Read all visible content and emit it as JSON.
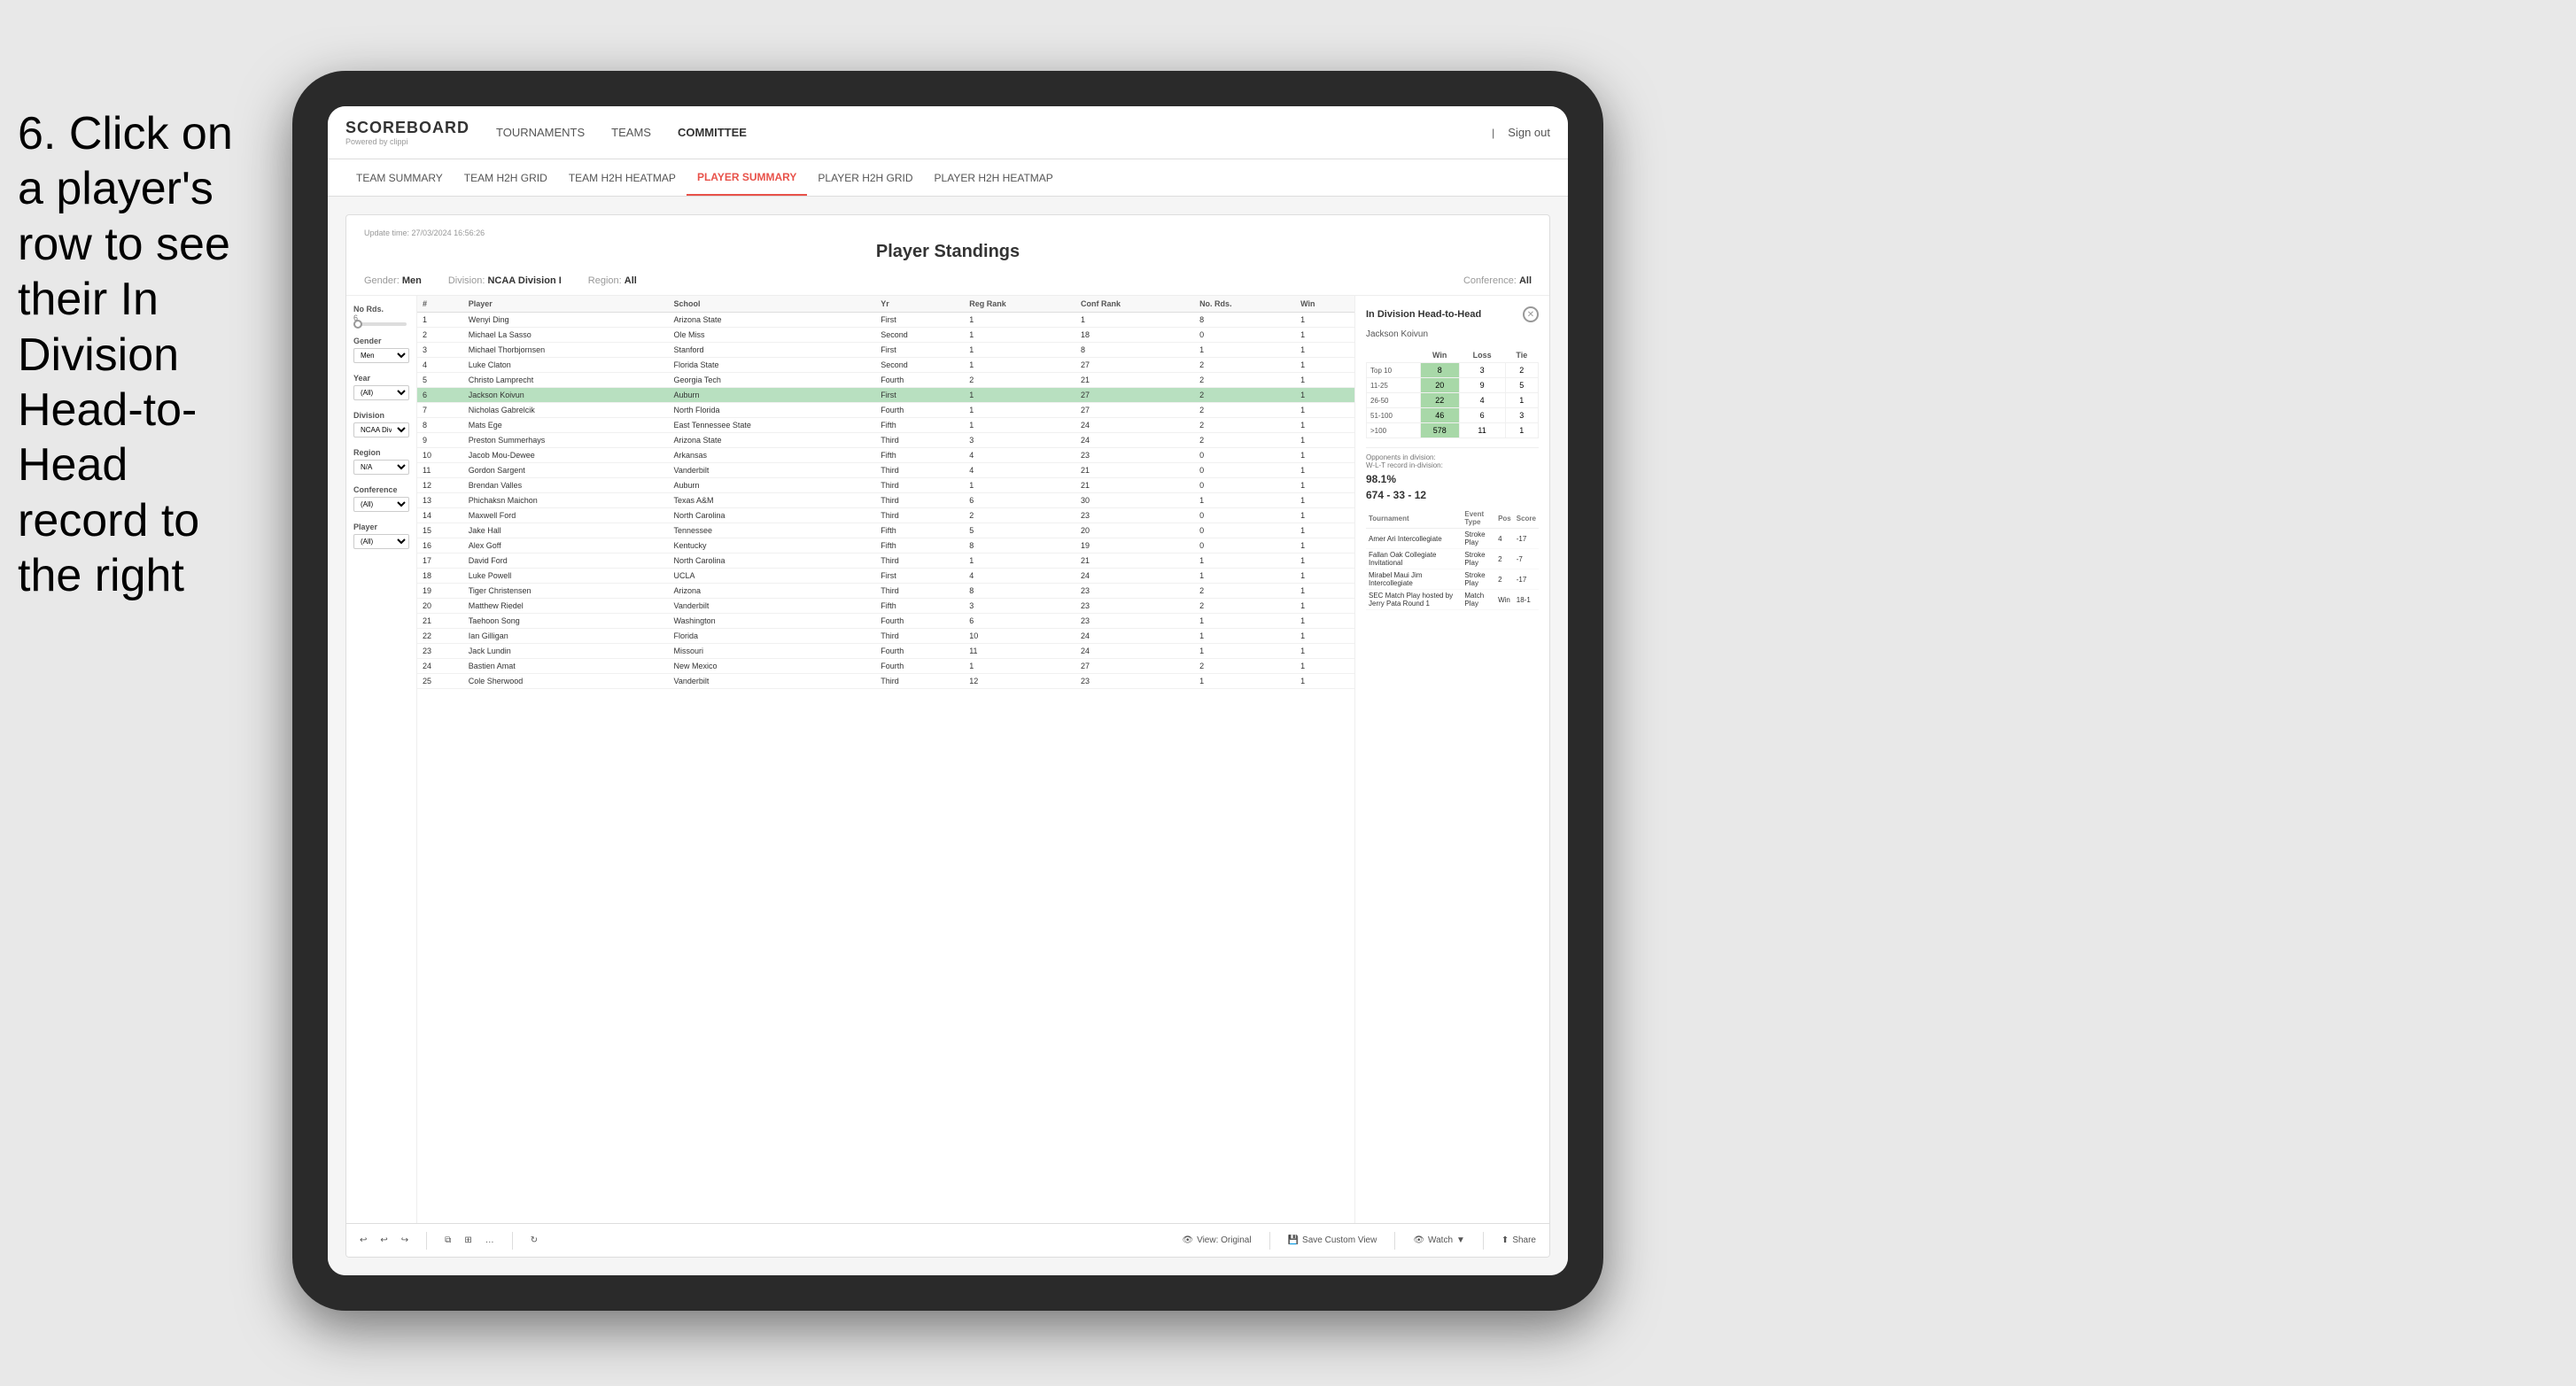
{
  "instruction": {
    "text": "6. Click on a player's row to see their In Division Head-to-Head record to the right"
  },
  "nav": {
    "logo": "SCOREBOARD",
    "powered_by": "Powered by clippi",
    "items": [
      "TOURNAMENTS",
      "TEAMS",
      "COMMITTEE"
    ],
    "sign_out": "Sign out"
  },
  "sub_nav": {
    "items": [
      "TEAM SUMMARY",
      "TEAM H2H GRID",
      "TEAM H2H HEATMAP",
      "PLAYER SUMMARY",
      "PLAYER H2H GRID",
      "PLAYER H2H HEATMAP"
    ],
    "active": "PLAYER SUMMARY"
  },
  "dashboard": {
    "update_label": "Update time:",
    "update_time": "27/03/2024 16:56:26",
    "title": "Player Standings",
    "filters": {
      "gender": {
        "label": "Gender:",
        "value": "Men"
      },
      "division": {
        "label": "Division:",
        "value": "NCAA Division I"
      },
      "region": {
        "label": "Region:",
        "value": "All"
      },
      "conference": {
        "label": "Conference:",
        "value": "All"
      }
    }
  },
  "sidebar_filters": {
    "no_rds_label": "No Rds.",
    "no_rds_value": "6",
    "gender_label": "Gender",
    "gender_value": "Men",
    "year_label": "Year",
    "year_value": "(All)",
    "division_label": "Division",
    "division_value": "NCAA Division I",
    "region_label": "Region",
    "region_value": "N/A",
    "conference_label": "Conference",
    "conference_value": "(All)",
    "player_label": "Player",
    "player_value": "(All)"
  },
  "table": {
    "headers": [
      "#",
      "Player",
      "School",
      "Yr",
      "Reg Rank",
      "Conf Rank",
      "No. Rds.",
      "Win"
    ],
    "rows": [
      {
        "rank": "1",
        "player": "Wenyi Ding",
        "school": "Arizona State",
        "yr": "First",
        "reg": "1",
        "conf": "1",
        "rds": "8",
        "win": "1",
        "highlighted": false
      },
      {
        "rank": "2",
        "player": "Michael La Sasso",
        "school": "Ole Miss",
        "yr": "Second",
        "reg": "1",
        "conf": "18",
        "rds": "0",
        "win": "1",
        "highlighted": false
      },
      {
        "rank": "3",
        "player": "Michael Thorbjornsen",
        "school": "Stanford",
        "yr": "First",
        "reg": "1",
        "conf": "8",
        "rds": "1",
        "win": "1",
        "highlighted": false
      },
      {
        "rank": "4",
        "player": "Luke Claton",
        "school": "Florida State",
        "yr": "Second",
        "reg": "1",
        "conf": "27",
        "rds": "2",
        "win": "1",
        "highlighted": false
      },
      {
        "rank": "5",
        "player": "Christo Lamprecht",
        "school": "Georgia Tech",
        "yr": "Fourth",
        "reg": "2",
        "conf": "21",
        "rds": "2",
        "win": "1",
        "highlighted": false
      },
      {
        "rank": "6",
        "player": "Jackson Koivun",
        "school": "Auburn",
        "yr": "First",
        "reg": "1",
        "conf": "27",
        "rds": "2",
        "win": "1",
        "highlighted": true
      },
      {
        "rank": "7",
        "player": "Nicholas Gabrelcik",
        "school": "North Florida",
        "yr": "Fourth",
        "reg": "1",
        "conf": "27",
        "rds": "2",
        "win": "1",
        "highlighted": false
      },
      {
        "rank": "8",
        "player": "Mats Ege",
        "school": "East Tennessee State",
        "yr": "Fifth",
        "reg": "1",
        "conf": "24",
        "rds": "2",
        "win": "1",
        "highlighted": false
      },
      {
        "rank": "9",
        "player": "Preston Summerhays",
        "school": "Arizona State",
        "yr": "Third",
        "reg": "3",
        "conf": "24",
        "rds": "2",
        "win": "1",
        "highlighted": false
      },
      {
        "rank": "10",
        "player": "Jacob Mou-Dewee",
        "school": "Arkansas",
        "yr": "Fifth",
        "reg": "4",
        "conf": "23",
        "rds": "0",
        "win": "1",
        "highlighted": false
      },
      {
        "rank": "11",
        "player": "Gordon Sargent",
        "school": "Vanderbilt",
        "yr": "Third",
        "reg": "4",
        "conf": "21",
        "rds": "0",
        "win": "1",
        "highlighted": false
      },
      {
        "rank": "12",
        "player": "Brendan Valles",
        "school": "Auburn",
        "yr": "Third",
        "reg": "1",
        "conf": "21",
        "rds": "0",
        "win": "1",
        "highlighted": false
      },
      {
        "rank": "13",
        "player": "Phichaksn Maichon",
        "school": "Texas A&M",
        "yr": "Third",
        "reg": "6",
        "conf": "30",
        "rds": "1",
        "win": "1",
        "highlighted": false
      },
      {
        "rank": "14",
        "player": "Maxwell Ford",
        "school": "North Carolina",
        "yr": "Third",
        "reg": "2",
        "conf": "23",
        "rds": "0",
        "win": "1",
        "highlighted": false
      },
      {
        "rank": "15",
        "player": "Jake Hall",
        "school": "Tennessee",
        "yr": "Fifth",
        "reg": "5",
        "conf": "20",
        "rds": "0",
        "win": "1",
        "highlighted": false
      },
      {
        "rank": "16",
        "player": "Alex Goff",
        "school": "Kentucky",
        "yr": "Fifth",
        "reg": "8",
        "conf": "19",
        "rds": "0",
        "win": "1",
        "highlighted": false
      },
      {
        "rank": "17",
        "player": "David Ford",
        "school": "North Carolina",
        "yr": "Third",
        "reg": "1",
        "conf": "21",
        "rds": "1",
        "win": "1",
        "highlighted": false
      },
      {
        "rank": "18",
        "player": "Luke Powell",
        "school": "UCLA",
        "yr": "First",
        "reg": "4",
        "conf": "24",
        "rds": "1",
        "win": "1",
        "highlighted": false
      },
      {
        "rank": "19",
        "player": "Tiger Christensen",
        "school": "Arizona",
        "yr": "Third",
        "reg": "8",
        "conf": "23",
        "rds": "2",
        "win": "1",
        "highlighted": false
      },
      {
        "rank": "20",
        "player": "Matthew Riedel",
        "school": "Vanderbilt",
        "yr": "Fifth",
        "reg": "3",
        "conf": "23",
        "rds": "2",
        "win": "1",
        "highlighted": false
      },
      {
        "rank": "21",
        "player": "Taehoon Song",
        "school": "Washington",
        "yr": "Fourth",
        "reg": "6",
        "conf": "23",
        "rds": "1",
        "win": "1",
        "highlighted": false
      },
      {
        "rank": "22",
        "player": "Ian Gilligan",
        "school": "Florida",
        "yr": "Third",
        "reg": "10",
        "conf": "24",
        "rds": "1",
        "win": "1",
        "highlighted": false
      },
      {
        "rank": "23",
        "player": "Jack Lundin",
        "school": "Missouri",
        "yr": "Fourth",
        "reg": "11",
        "conf": "24",
        "rds": "1",
        "win": "1",
        "highlighted": false
      },
      {
        "rank": "24",
        "player": "Bastien Amat",
        "school": "New Mexico",
        "yr": "Fourth",
        "reg": "1",
        "conf": "27",
        "rds": "2",
        "win": "1",
        "highlighted": false
      },
      {
        "rank": "25",
        "player": "Cole Sherwood",
        "school": "Vanderbilt",
        "yr": "Third",
        "reg": "12",
        "conf": "23",
        "rds": "1",
        "win": "1",
        "highlighted": false
      }
    ]
  },
  "h2h_panel": {
    "title": "In Division Head-to-Head",
    "player_name": "Jackson Koivun",
    "col_headers": [
      "Win",
      "Loss",
      "Tie"
    ],
    "rows": [
      {
        "label": "Top 10",
        "win": "8",
        "loss": "3",
        "tie": "2"
      },
      {
        "label": "11-25",
        "win": "20",
        "loss": "9",
        "tie": "5"
      },
      {
        "label": "26-50",
        "win": "22",
        "loss": "4",
        "tie": "1"
      },
      {
        "label": "51-100",
        "win": "46",
        "loss": "6",
        "tie": "3"
      },
      {
        ">100": ">100",
        "win": "578",
        "loss": "11",
        "tie": "1"
      }
    ],
    "opponents_label": "Opponents in division:",
    "wlt_label": "W-L-T record in-division:",
    "pct": "98.1%",
    "record": "674 - 33 - 12",
    "tournaments": [
      {
        "name": "Amer Ari Intercollegiate",
        "type": "Stroke Play",
        "pos": "4",
        "score": "-17"
      },
      {
        "name": "Fallan Oak Collegiate Invitational",
        "type": "Stroke Play",
        "pos": "2",
        "score": "-7"
      },
      {
        "name": "Mirabel Maui Jim Intercollegiate",
        "type": "Stroke Play",
        "pos": "2",
        "score": "-17"
      },
      {
        "name": "SEC Match Play hosted by Jerry Pata Round 1",
        "type": "Match Play",
        "pos": "Win",
        "score": "18-1"
      }
    ],
    "tournament_headers": [
      "Tournament",
      "Event Type",
      "Pos",
      "Score"
    ]
  },
  "toolbar": {
    "view_original": "View: Original",
    "save_custom": "Save Custom View",
    "watch": "Watch",
    "share": "Share"
  }
}
